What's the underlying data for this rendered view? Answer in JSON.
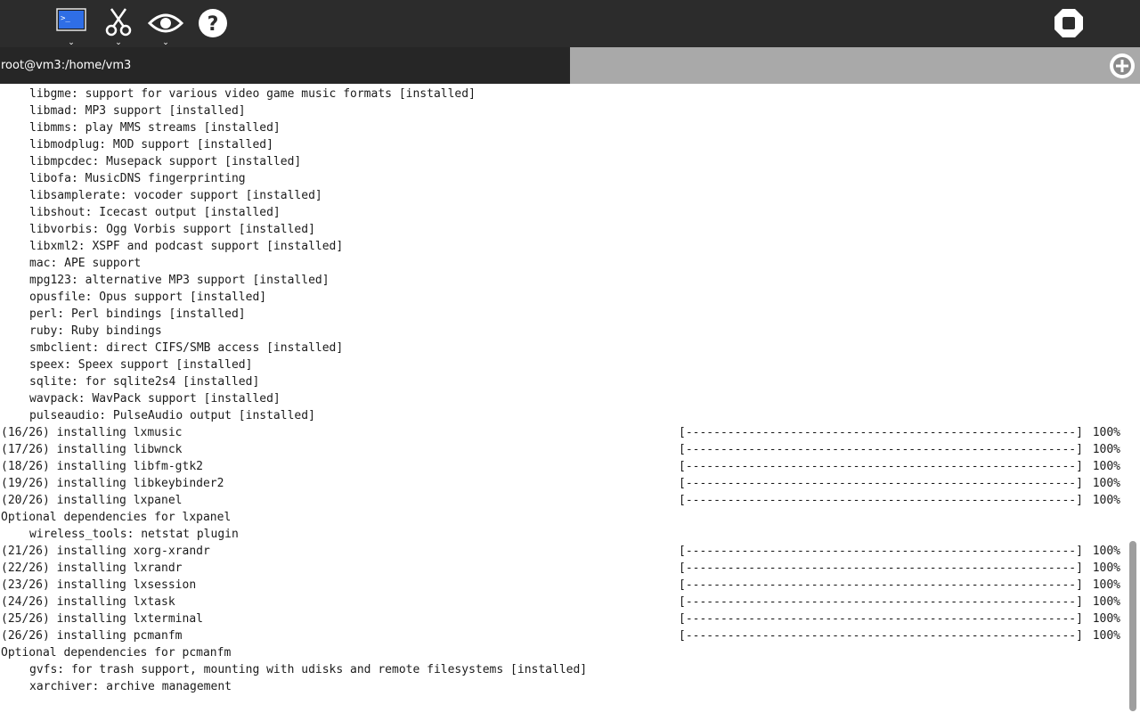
{
  "toolbar": {
    "buttons": [
      {
        "name": "terminal-button",
        "icon": "terminal-icon",
        "dropdown": "⌄"
      },
      {
        "name": "cut-button",
        "icon": "scissors-icon",
        "dropdown": "⌄"
      },
      {
        "name": "view-button",
        "icon": "eye-icon",
        "dropdown": "⌄"
      },
      {
        "name": "help-button",
        "icon": "help-icon"
      }
    ],
    "stop_icon": "stop-icon",
    "accent": "#2f6ee6"
  },
  "tabs": {
    "active_title": "root@vm3:/home/vm3",
    "new_tab_icon": "plus-circle-icon"
  },
  "terminal": {
    "lines": [
      {
        "text": "libgme: support for various video game music formats [installed]",
        "indent": true
      },
      {
        "text": "libmad: MP3 support [installed]",
        "indent": true
      },
      {
        "text": "libmms: play MMS streams [installed]",
        "indent": true
      },
      {
        "text": "libmodplug: MOD support [installed]",
        "indent": true
      },
      {
        "text": "libmpcdec: Musepack support [installed]",
        "indent": true
      },
      {
        "text": "libofa: MusicDNS fingerprinting",
        "indent": true
      },
      {
        "text": "libsamplerate: vocoder support [installed]",
        "indent": true
      },
      {
        "text": "libshout: Icecast output [installed]",
        "indent": true
      },
      {
        "text": "libvorbis: Ogg Vorbis support [installed]",
        "indent": true
      },
      {
        "text": "libxml2: XSPF and podcast support [installed]",
        "indent": true
      },
      {
        "text": "mac: APE support",
        "indent": true
      },
      {
        "text": "mpg123: alternative MP3 support [installed]",
        "indent": true
      },
      {
        "text": "opusfile: Opus support [installed]",
        "indent": true
      },
      {
        "text": "perl: Perl bindings [installed]",
        "indent": true
      },
      {
        "text": "ruby: Ruby bindings",
        "indent": true
      },
      {
        "text": "smbclient: direct CIFS/SMB access [installed]",
        "indent": true
      },
      {
        "text": "speex: Speex support [installed]",
        "indent": true
      },
      {
        "text": "sqlite: for sqlite2s4 [installed]",
        "indent": true
      },
      {
        "text": "wavpack: WavPack support [installed]",
        "indent": true
      },
      {
        "text": "pulseaudio: PulseAudio output [installed]",
        "indent": true
      },
      {
        "text": "(16/26) installing lxmusic",
        "progress": "[--------------------------------------------------------] 100%"
      },
      {
        "text": "(17/26) installing libwnck",
        "progress": "[--------------------------------------------------------] 100%"
      },
      {
        "text": "(18/26) installing libfm-gtk2",
        "progress": "[--------------------------------------------------------] 100%"
      },
      {
        "text": "(19/26) installing libkeybinder2",
        "progress": "[--------------------------------------------------------] 100%"
      },
      {
        "text": "(20/26) installing lxpanel",
        "progress": "[--------------------------------------------------------] 100%"
      },
      {
        "text": "Optional dependencies for lxpanel"
      },
      {
        "text": "wireless_tools: netstat plugin",
        "indent": true
      },
      {
        "text": "(21/26) installing xorg-xrandr",
        "progress": "[--------------------------------------------------------] 100%"
      },
      {
        "text": "(22/26) installing lxrandr",
        "progress": "[--------------------------------------------------------] 100%"
      },
      {
        "text": "(23/26) installing lxsession",
        "progress": "[--------------------------------------------------------] 100%"
      },
      {
        "text": "(24/26) installing lxtask",
        "progress": "[--------------------------------------------------------] 100%"
      },
      {
        "text": "(25/26) installing lxterminal",
        "progress": "[--------------------------------------------------------] 100%"
      },
      {
        "text": "(26/26) installing pcmanfm",
        "progress": "[--------------------------------------------------------] 100%"
      },
      {
        "text": "Optional dependencies for pcmanfm"
      },
      {
        "text": "gvfs: for trash support, mounting with udisks and remote filesystems [installed]",
        "indent": true
      },
      {
        "text": "xarchiver: archive management",
        "indent": true
      }
    ]
  },
  "scrollbar": {
    "position_fraction": 1.0,
    "visible_fraction": 0.27
  }
}
